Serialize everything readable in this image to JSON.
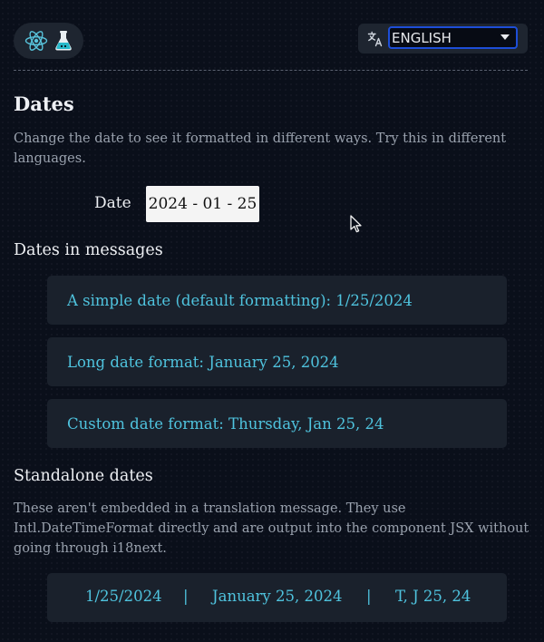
{
  "header": {
    "logo_icons": [
      "react-icon",
      "flask-icon"
    ],
    "language_select": {
      "icon": "translate-icon",
      "value": "ENGLISH"
    }
  },
  "section": {
    "title": "Dates",
    "intro": "Change the date to see it formatted in different ways. Try this in different languages.",
    "date_label": "Date",
    "date_value": "2024 - 01 - 25"
  },
  "messages": {
    "title": "Dates in messages",
    "items": [
      "A simple date (default formatting): 1/25/2024",
      "Long date format: January 25, 2024",
      "Custom date format: Thursday, Jan 25, 24"
    ]
  },
  "standalone": {
    "title": "Standalone dates",
    "description": "These aren't embedded in a translation message. They use Intl.DateTimeFormat directly and are output into the component JSX without going through i18next.",
    "values": [
      "1/25/2024",
      "January 25, 2024",
      "T, J 25, 24"
    ],
    "separators": [
      "|",
      "|"
    ]
  },
  "colors": {
    "background": "#0a0f1a",
    "card": "#1a212c",
    "accent_text": "#4fc3de",
    "select_border": "#1d4ed8"
  }
}
